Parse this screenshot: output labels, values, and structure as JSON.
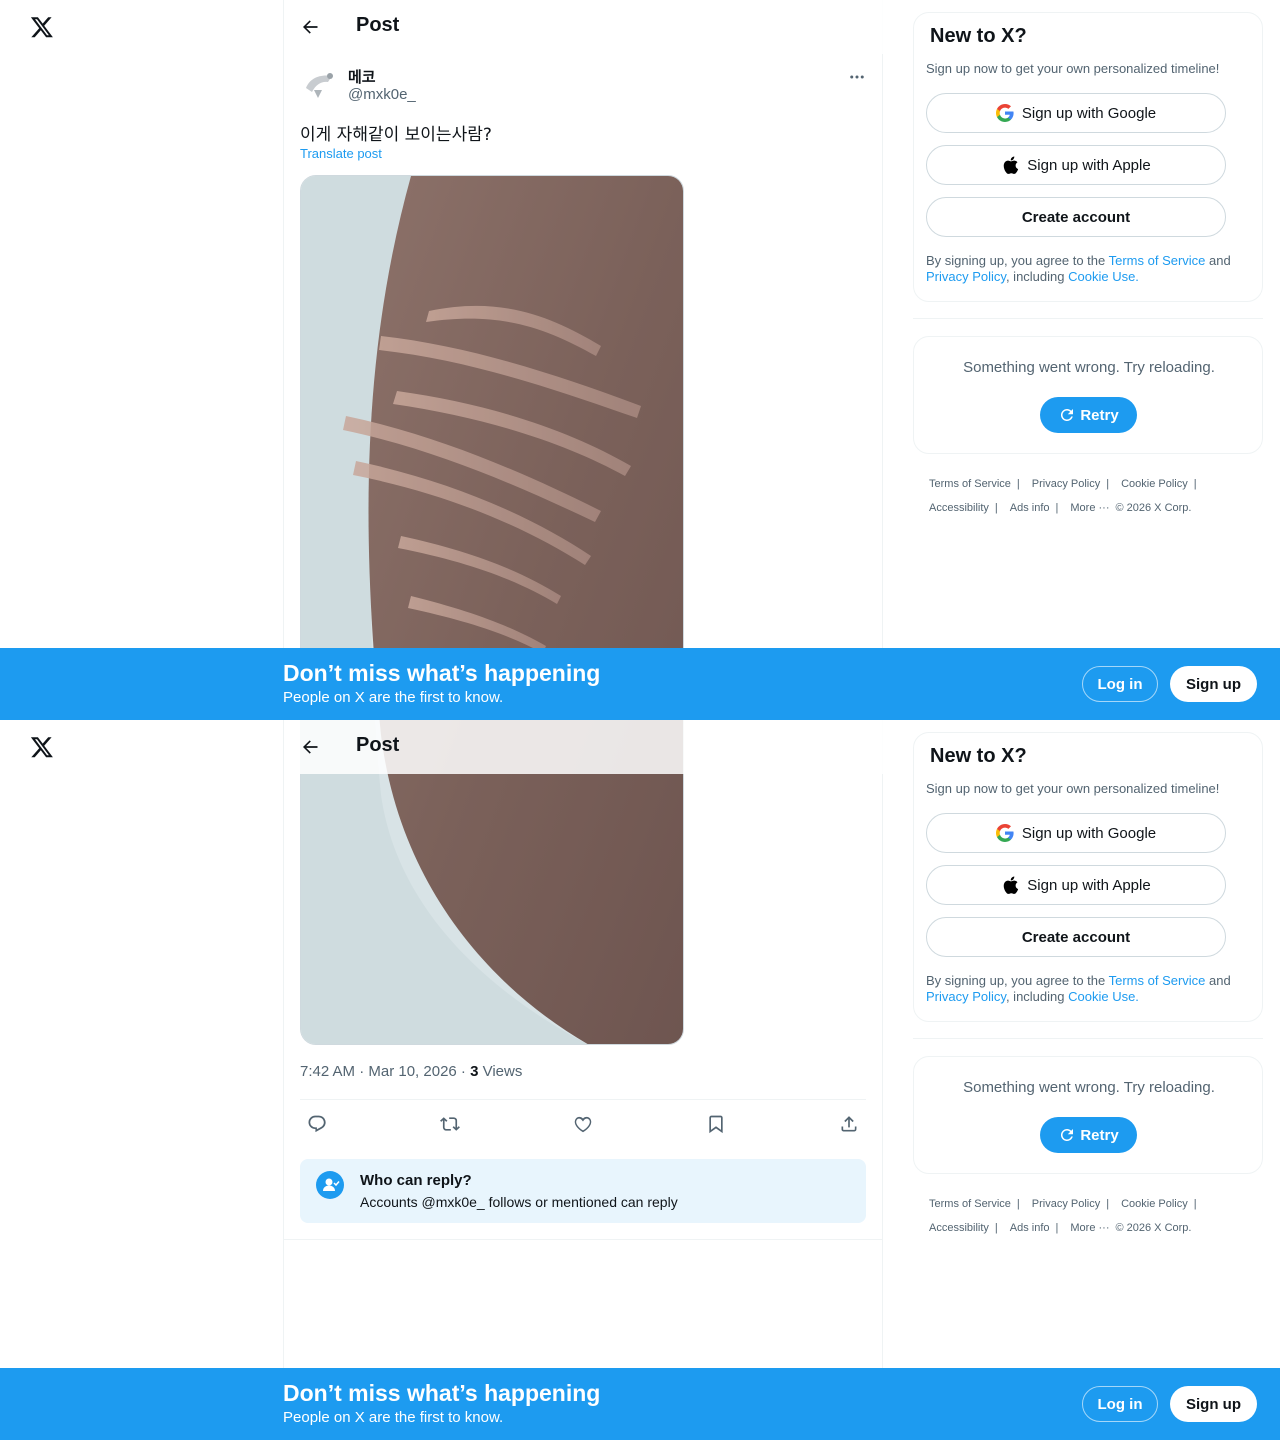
{
  "header": {
    "title": "Post"
  },
  "post": {
    "display_name": "메코",
    "handle": "@mxk0e_",
    "text": "이게 자해같이 보이는사람?",
    "translate_label": "Translate post",
    "time": "7:42 AM · Mar 10, 2026",
    "separator": " · ",
    "views_count": "3",
    "views_label": " Views"
  },
  "reply_settings": {
    "title": "Who can reply?",
    "description": "Accounts @mxk0e_ follows or mentioned can reply"
  },
  "sidebar": {
    "signup_title": "New to X?",
    "signup_subtitle": "Sign up now to get your own personalized timeline!",
    "google_label": "Sign up with Google",
    "apple_label": "Sign up with Apple",
    "create_label": "Create account",
    "legal_prefix": "By signing up, you agree to the ",
    "terms_link": "Terms of Service",
    "legal_and": " and ",
    "privacy_link": "Privacy Policy",
    "legal_including": ", including ",
    "cookie_link": "Cookie Use.",
    "error_text": "Something went wrong. Try reloading.",
    "retry_label": "Retry"
  },
  "footer": {
    "terms": "Terms of Service",
    "privacy": "Privacy Policy",
    "cookie": "Cookie Policy",
    "accessibility": "Accessibility",
    "ads": "Ads info",
    "more": "More ···",
    "copyright": "© 2026 X Corp."
  },
  "banner": {
    "title": "Don’t miss what’s happening",
    "subtitle": "People on X are the first to know.",
    "login": "Log in",
    "signup": "Sign up"
  },
  "colors": {
    "accent": "#1d9bf0",
    "text": "#0f1419",
    "secondary": "#536471"
  },
  "icons": [
    "x-logo-icon",
    "back-arrow-icon",
    "more-icon",
    "reply-icon",
    "repost-icon",
    "like-icon",
    "bookmark-icon",
    "share-icon",
    "google-icon",
    "apple-icon",
    "retry-icon",
    "mention-icon"
  ]
}
